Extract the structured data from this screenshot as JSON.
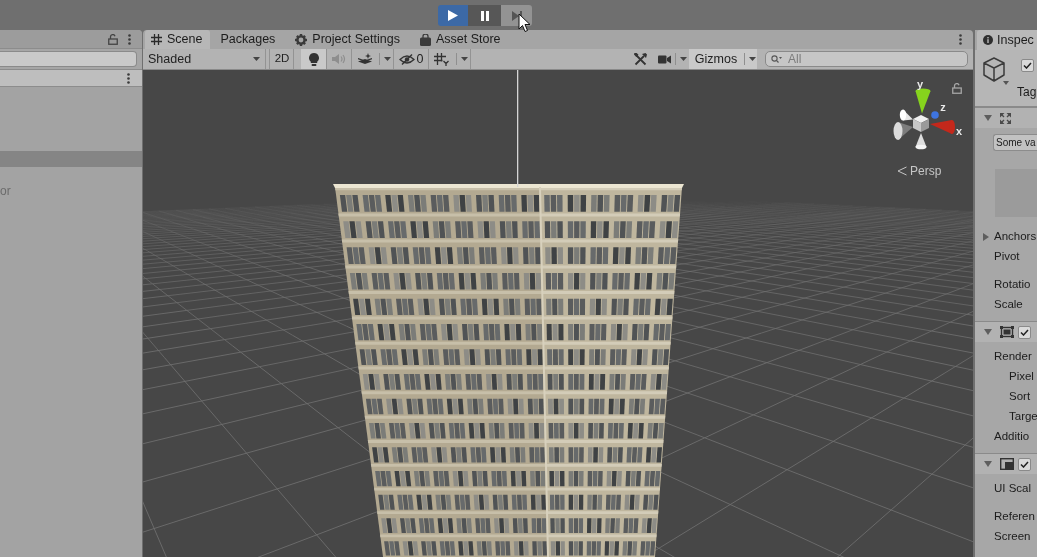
{
  "toolbar": {
    "play_controls": [
      {
        "kind": "play",
        "selected": true,
        "hovered": false
      },
      {
        "kind": "pause",
        "selected": false,
        "hovered": false
      },
      {
        "kind": "step",
        "selected": false,
        "hovered": true
      }
    ]
  },
  "left_panel": {
    "rows": [
      {
        "selected": false
      },
      {
        "selected": false
      },
      {
        "selected": false
      },
      {
        "selected": false
      },
      {
        "selected": true
      },
      {
        "selected": false
      },
      {
        "text": "or",
        "selected": false
      }
    ]
  },
  "scene_panel": {
    "tabs": [
      {
        "kind": "scene",
        "label": "Scene",
        "selected": true
      },
      {
        "kind": "plain",
        "label": "Packages",
        "selected": false
      },
      {
        "kind": "settings",
        "label": "Project Settings",
        "selected": false
      },
      {
        "kind": "store",
        "label": "Asset Store",
        "selected": false
      }
    ],
    "toolbar": {
      "shading": {
        "value": "Shaded"
      },
      "left_tools": [
        {
          "kind": "mode2d",
          "label": "2D",
          "on": false,
          "disabled": false
        },
        {
          "kind": "lighting",
          "on": true,
          "disabled": false
        },
        {
          "kind": "audio",
          "on": false,
          "disabled": true
        },
        {
          "kind": "effects",
          "on": false,
          "disabled": false,
          "dropdown": true
        },
        {
          "kind": "hidden",
          "label": "0",
          "on": false,
          "disabled": false
        },
        {
          "kind": "grid",
          "on": false,
          "disabled": false,
          "dropdown": true
        }
      ],
      "right_tools": [
        {
          "kind": "tools",
          "on": false
        },
        {
          "kind": "camera",
          "on": false,
          "dropdown": true
        },
        {
          "kind": "gizmos",
          "label": "Gizmos",
          "on": true,
          "dropdown": true
        }
      ],
      "search": {
        "placeholder": "All"
      }
    },
    "viewport": {
      "gizmo": {
        "axes": [
          {
            "label": "y",
            "color": "#86d31d"
          },
          {
            "label": "z",
            "color": "#3e74df"
          },
          {
            "label": "x",
            "color": "#c4281b"
          }
        ],
        "projection": "Persp"
      }
    }
  },
  "inspector": {
    "tab": {
      "label": "Inspec",
      "selected": true
    },
    "object": {
      "active": true,
      "tag_label": "Tag"
    },
    "components": [
      {
        "kind": "rect_transform",
        "expanded": true,
        "groups": [
          [
            {
              "kind": "dropdown",
              "value": "Some va"
            }
          ],
          [
            {
              "kind": "preview"
            }
          ],
          [
            {
              "kind": "foldout",
              "label": "Anchors",
              "expanded": false
            },
            {
              "kind": "field",
              "label": "Pivot"
            }
          ],
          [
            {
              "kind": "field",
              "label": "Rotatio"
            },
            {
              "kind": "field",
              "label": "Scale"
            }
          ]
        ]
      },
      {
        "kind": "canvas",
        "expanded": true,
        "toggle": {
          "checked": true
        },
        "groups": [
          [
            {
              "kind": "field",
              "label": "Render",
              "children": [
                {
                  "kind": "field",
                  "label": "Pixel"
                },
                {
                  "kind": "field",
                  "label": "Sort"
                },
                {
                  "kind": "field",
                  "label": "Targe"
                }
              ]
            },
            {
              "kind": "field",
              "label": "Additio"
            }
          ]
        ]
      },
      {
        "kind": "canvas_scaler",
        "expanded": true,
        "toggle": {
          "checked": true
        },
        "groups": [
          [
            {
              "kind": "field",
              "label": "UI Scal"
            }
          ],
          [
            {
              "kind": "field",
              "label": "Referen"
            },
            {
              "kind": "field",
              "label": "Screen"
            }
          ]
        ]
      }
    ]
  }
}
